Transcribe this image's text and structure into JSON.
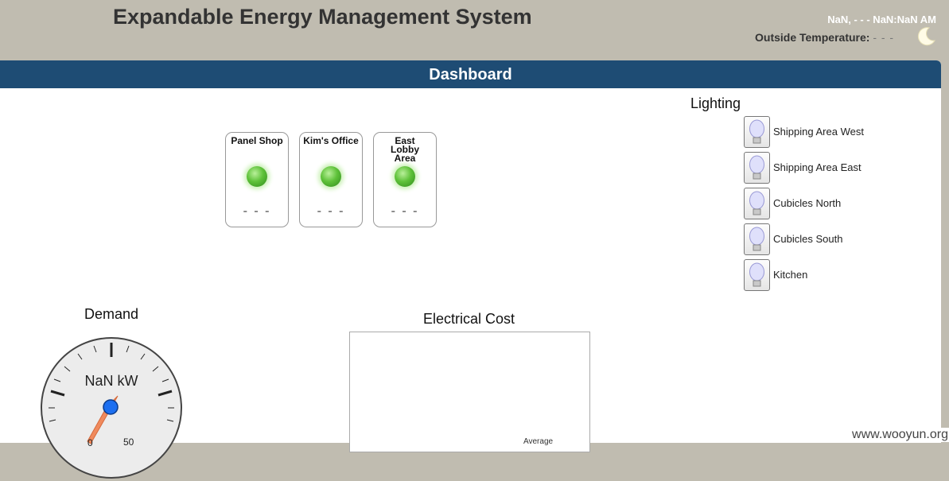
{
  "header": {
    "title": "Expandable Energy Management System",
    "datetime": "NaN, - - - NaN:NaN AM",
    "outside_label": "Outside Temperature:",
    "outside_value": "- - -",
    "weather_icon": "moon-icon"
  },
  "tab": {
    "label": "Dashboard"
  },
  "zones": [
    {
      "name": "Panel Shop",
      "value": "- - -",
      "status_color": "#5fc23a"
    },
    {
      "name": "Kim's Office",
      "value": "- - -",
      "status_color": "#5fc23a"
    },
    {
      "name": "East Lobby Area",
      "value": "- - -",
      "status_color": "#5fc23a"
    }
  ],
  "lighting": {
    "title": "Lighting",
    "items": [
      {
        "label": "Shipping Area West",
        "icon": "light-bulb-icon"
      },
      {
        "label": "Shipping Area East",
        "icon": "light-bulb-icon"
      },
      {
        "label": "Cubicles North",
        "icon": "light-bulb-icon"
      },
      {
        "label": "Cubicles South",
        "icon": "light-bulb-icon"
      },
      {
        "label": "Kitchen",
        "icon": "light-bulb-icon"
      }
    ]
  },
  "demand": {
    "title": "Demand",
    "value_text": "NaN kW",
    "tick_labels": [
      "0",
      "50"
    ]
  },
  "cost": {
    "title": "Electrical Cost",
    "legend_partial": "Average"
  },
  "watermark": "www.wooyun.org"
}
